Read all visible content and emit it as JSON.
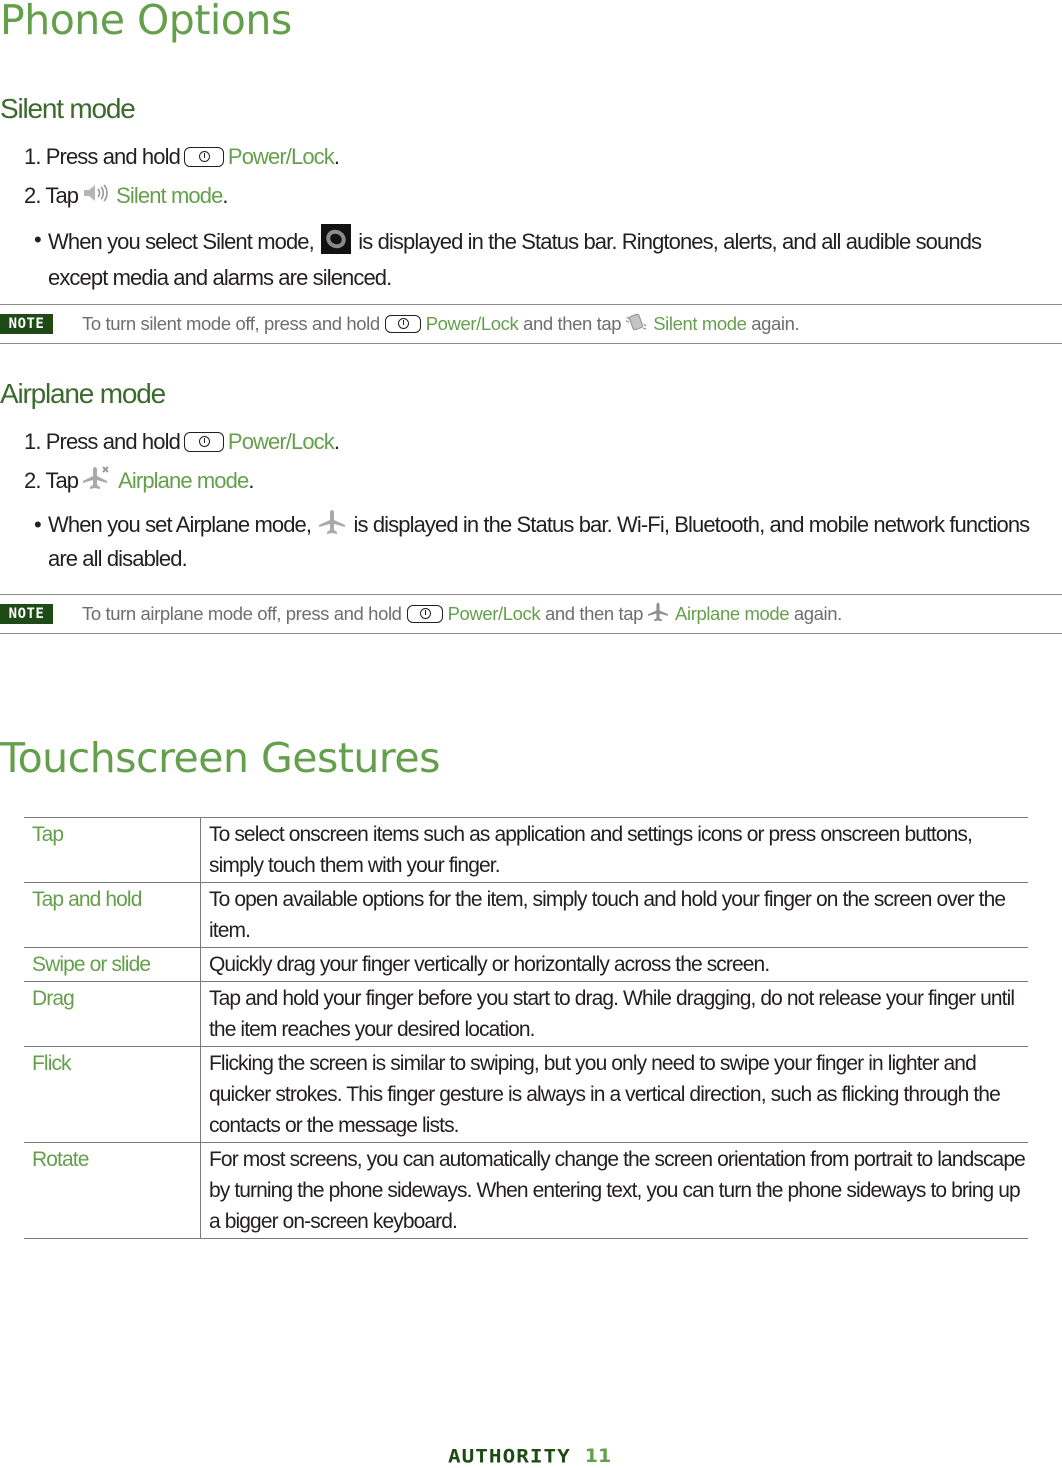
{
  "page_title": "Phone Options",
  "silent_mode": {
    "heading": "Silent mode",
    "step1": {
      "prefix": "1. Press and hold",
      "link": "Power/Lock",
      "suffix": "."
    },
    "step2": {
      "prefix": "2. Tap",
      "link": "Silent mode",
      "suffix": "."
    },
    "bullet_before_icon": "When you select Silent mode,",
    "bullet_after_icon": "is displayed in the Status bar. Ringtones, alerts, and all audible sounds except media and alarms are silenced.",
    "icons": {
      "key": "power-key-icon",
      "step_icon": "speaker-icon",
      "status_icon": "vibrate-status-icon"
    },
    "note": {
      "badge": "NOTE",
      "part1": "To turn silent mode off, press and hold",
      "link1": "Power/Lock",
      "part2": "and then tap",
      "link2": "Silent mode",
      "part3": "again."
    }
  },
  "airplane_mode": {
    "heading": "Airplane mode",
    "step1": {
      "prefix": "1. Press and hold",
      "link": "Power/Lock",
      "suffix": "."
    },
    "step2": {
      "prefix": "2. Tap",
      "link": "Airplane mode",
      "suffix": "."
    },
    "bullet_before_icon": "When you set Airplane mode,",
    "bullet_after_icon": "is displayed in the Status bar. Wi-Fi, Bluetooth, and mobile network functions are all disabled.",
    "icons": {
      "key": "power-key-icon",
      "step_icon": "airplane-off-icon",
      "status_icon": "airplane-icon"
    },
    "note": {
      "badge": "NOTE",
      "part1": "To turn airplane mode off, press and hold",
      "link1": "Power/Lock",
      "part2": "and then tap",
      "link2": "Airplane mode",
      "part3": "again."
    }
  },
  "gestures": {
    "heading": "Touchscreen Gestures",
    "rows": [
      {
        "term": "Tap",
        "desc": "To select onscreen items such as application and settings icons or press onscreen buttons, simply touch them with your finger."
      },
      {
        "term": "Tap and hold",
        "desc": "To open available options for the item, simply touch and hold your finger on the screen over the item."
      },
      {
        "term": "Swipe or slide",
        "desc": "Quickly drag your finger vertically or horizontally across the screen."
      },
      {
        "term": "Drag",
        "desc": "Tap and hold your finger before you start to drag. While dragging, do not release your finger until the item reaches your desired location."
      },
      {
        "term": "Flick",
        "desc": "Flicking the screen is similar to swiping, but you only need to swipe your finger in lighter and quicker strokes. This finger gesture is always in a vertical direction, such as flicking through the contacts or the message lists."
      },
      {
        "term": "Rotate",
        "desc": "For most screens, you can automatically change the screen orientation from portrait to landscape by turning the phone sideways. When entering text, you can turn the phone sideways to bring up a bigger on-screen keyboard."
      }
    ]
  },
  "footer": {
    "brand": "AUTHORITY",
    "page_number": "11"
  },
  "colors": {
    "accent_green": "#64a04c",
    "heading_dark_green": "#3c6a2e",
    "note_badge_bg": "#1e4a16",
    "body_text": "#231f20",
    "note_text": "#6d6e71"
  }
}
